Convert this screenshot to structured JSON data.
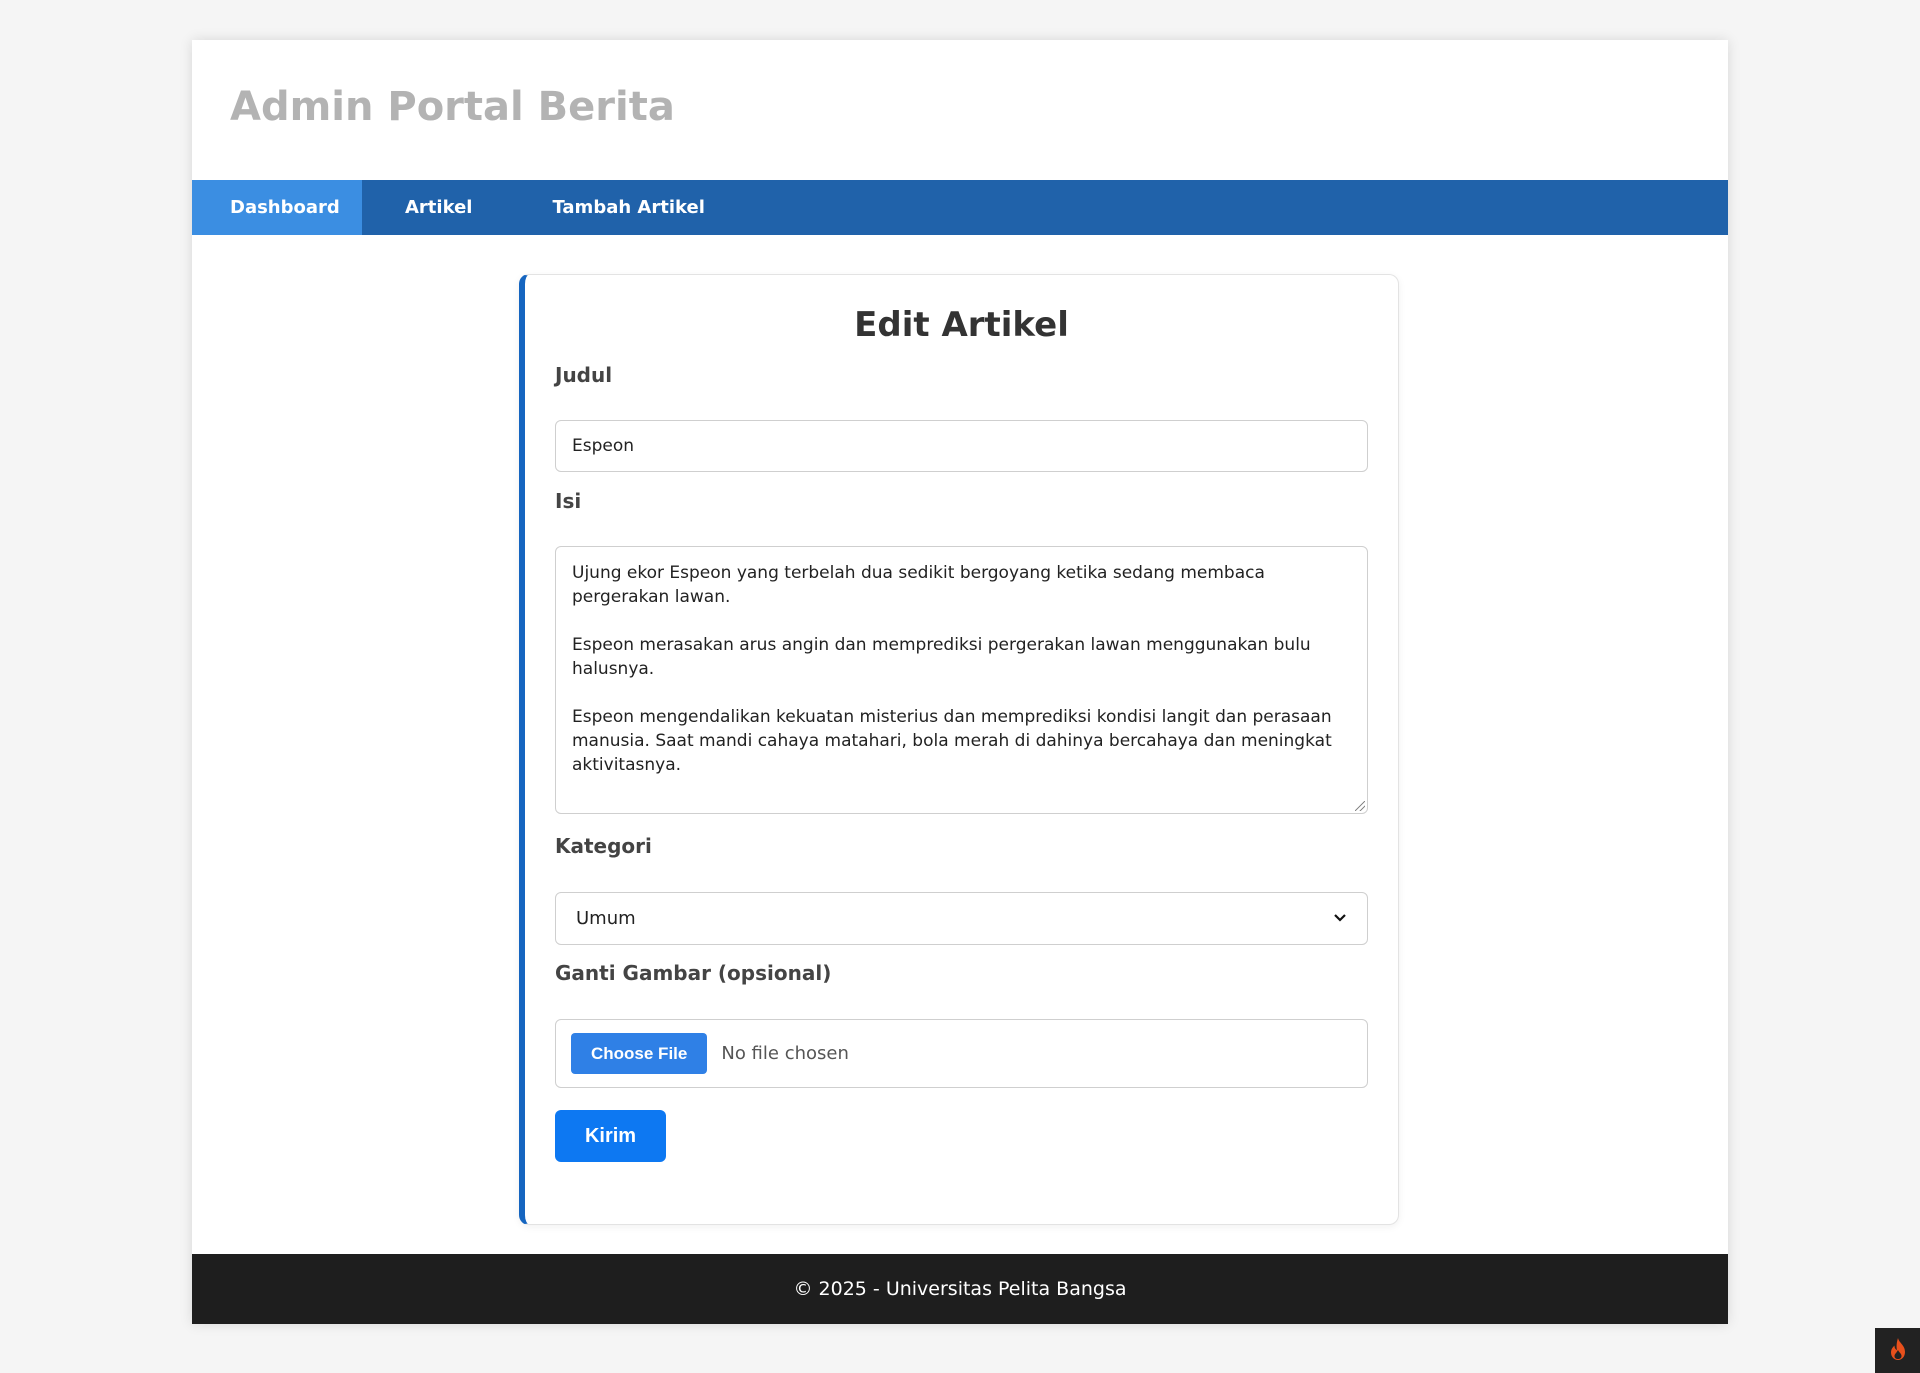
{
  "header": {
    "title": "Admin Portal Berita"
  },
  "nav": {
    "items": [
      {
        "label": "Dashboard"
      },
      {
        "label": "Artikel"
      },
      {
        "label": "Tambah Artikel"
      }
    ]
  },
  "form": {
    "title": "Edit Artikel",
    "judul": {
      "label": "Judul",
      "value": "Espeon"
    },
    "isi": {
      "label": "Isi",
      "value": "Ujung ekor Espeon yang terbelah dua sedikit bergoyang ketika sedang membaca pergerakan lawan.\n\nEspeon merasakan arus angin dan memprediksi pergerakan lawan menggunakan bulu halusnya.\n\nEspeon mengendalikan kekuatan misterius dan memprediksi kondisi langit dan perasaan manusia. Saat mandi cahaya matahari, bola merah di dahinya bercahaya dan meningkat aktivitasnya."
    },
    "kategori": {
      "label": "Kategori",
      "selected": "Umum"
    },
    "gambar": {
      "label": "Ganti Gambar (opsional)",
      "button": "Choose File",
      "status": "No file chosen"
    },
    "submit": "Kirim"
  },
  "footer": {
    "text": "© 2025 - Universitas Pelita Bangsa"
  },
  "colors": {
    "nav": "#2062aa",
    "nav_active": "#3b8ee2",
    "primary": "#0d78f2",
    "footer": "#1e1e1e"
  },
  "icons": {
    "select": "chevron-down-icon",
    "corner": "fire-icon"
  }
}
